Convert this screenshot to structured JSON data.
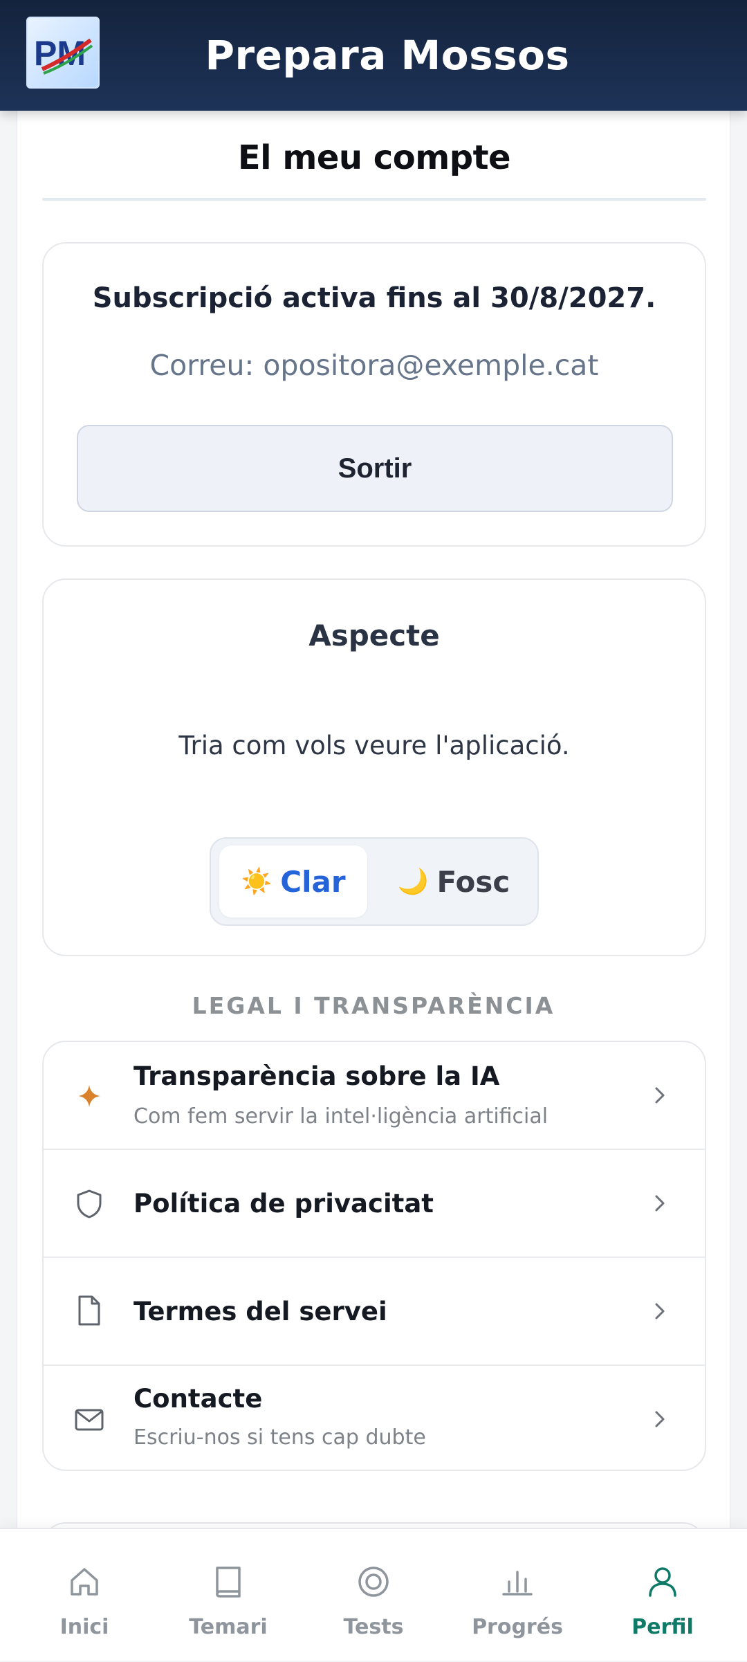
{
  "header": {
    "title": "Prepara Mossos",
    "logo_text": "PM"
  },
  "page": {
    "title": "El meu compte"
  },
  "subscription": {
    "status_text": "Subscripció activa fins al 30/8/2027.",
    "email_text": "Correu: opositora@exemple.cat",
    "logout_label": "Sortir"
  },
  "appearance": {
    "title": "Aspecte",
    "description": "Tria com vols veure l'aplicació.",
    "options": [
      {
        "label": "Clar",
        "emoji": "☀️",
        "selected": true
      },
      {
        "label": "Fosc",
        "emoji": "🌙",
        "selected": false
      }
    ]
  },
  "legal": {
    "section_label": "LEGAL I TRANSPARÈNCIA",
    "items": [
      {
        "title": "Transparència sobre la IA",
        "subtitle": "Com fem servir la intel·ligència artificial",
        "icon": "sparkle-icon"
      },
      {
        "title": "Política de privacitat",
        "subtitle": "",
        "icon": "shield-icon"
      },
      {
        "title": "Termes del servei",
        "subtitle": "",
        "icon": "document-icon"
      },
      {
        "title": "Contacte",
        "subtitle": "Escriu-nos si tens cap dubte",
        "icon": "mail-icon"
      }
    ]
  },
  "nav": {
    "items": [
      {
        "label": "Inici",
        "icon": "home-icon",
        "active": false
      },
      {
        "label": "Temari",
        "icon": "book-icon",
        "active": false
      },
      {
        "label": "Tests",
        "icon": "target-icon",
        "active": false
      },
      {
        "label": "Progrés",
        "icon": "bar-chart-icon",
        "active": false
      },
      {
        "label": "Perfil",
        "icon": "user-icon",
        "active": true
      }
    ]
  },
  "colors": {
    "header_bg": "#1d3358",
    "accent_blue": "#2563d9",
    "active_nav": "#0f7a68",
    "sparkle": "#d9822b"
  }
}
